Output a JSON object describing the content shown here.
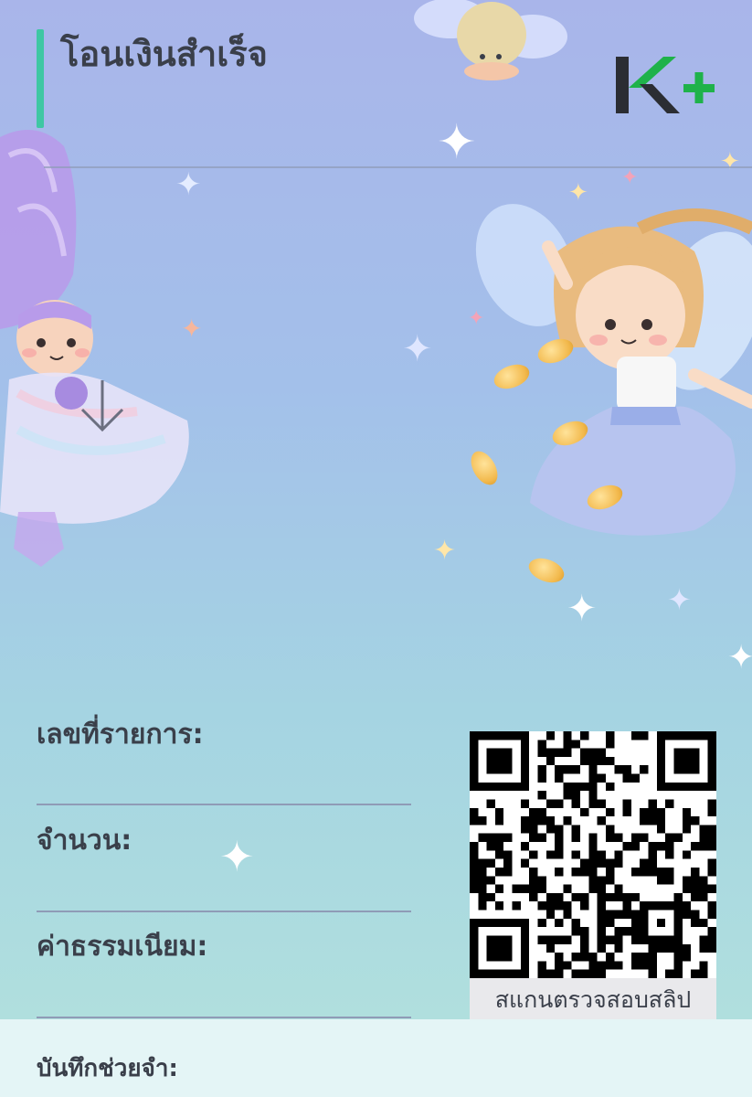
{
  "header": {
    "title": "โอนเงินสำเร็จ",
    "logo_text": "K+",
    "logo_colors": {
      "k": "#2b2d33",
      "plus": "#1fb24a"
    },
    "accent_color": "#3fc7a3"
  },
  "fields": {
    "transaction_no_label": "เลขที่รายการ:",
    "amount_label": "จำนวน:",
    "fee_label": "ค่าธรรมเนียม:",
    "memo_label": "บันทึกช่วยจำ:"
  },
  "qr": {
    "caption": "สแกนตรวจสอบสลิป"
  },
  "decorations": {
    "background_icons": [
      "fairy-purple-illustration",
      "fairy-blonde-illustration",
      "fairy-top-illustration",
      "download-arrow-icon",
      "sparkle-stars",
      "gold-coins"
    ]
  }
}
